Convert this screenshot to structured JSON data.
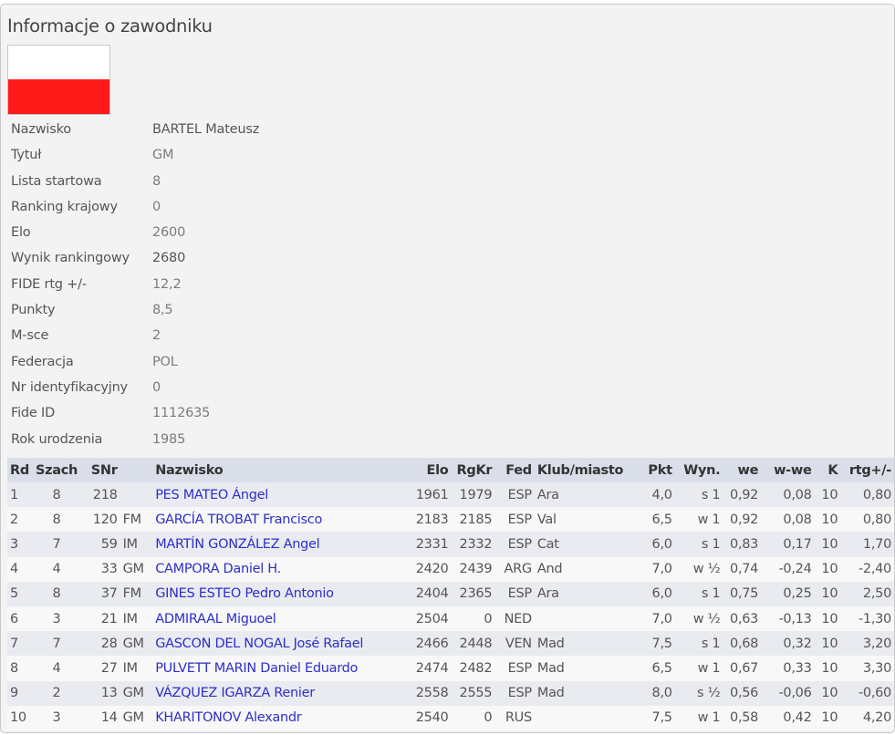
{
  "page_title": "Informacje o zawodniku",
  "flag": {
    "icon": "poland-flag-icon",
    "colors": [
      "#ffffff",
      "#ff1a1a"
    ]
  },
  "player": [
    {
      "label": "Nazwisko",
      "value": "BARTEL Mateusz"
    },
    {
      "label": "Tytuł",
      "value": "GM"
    },
    {
      "label": "Lista startowa",
      "value": "8"
    },
    {
      "label": "Ranking krajowy",
      "value": "0"
    },
    {
      "label": "Elo",
      "value": "2600"
    },
    {
      "label": "Wynik rankingowy",
      "value": "2680"
    },
    {
      "label": "FIDE rtg +/-",
      "value": "12,2"
    },
    {
      "label": "Punkty",
      "value": "8,5"
    },
    {
      "label": "M-sce",
      "value": "2"
    },
    {
      "label": "Federacja",
      "value": "POL"
    },
    {
      "label": "Nr identyfikacyjny",
      "value": "0"
    },
    {
      "label": "Fide ID",
      "value": "1112635"
    },
    {
      "label": "Rok urodzenia",
      "value": "1985"
    }
  ],
  "games_table": {
    "headers": [
      "Rd",
      "Szach",
      "SNr",
      "",
      "Nazwisko",
      "Elo",
      "RgKr",
      "Fed",
      "Klub/miasto",
      "Pkt",
      "Wyn.",
      "we",
      "w-we",
      "K",
      "rtg+/-"
    ],
    "rows": [
      [
        "1",
        "8",
        "218",
        "",
        "PES MATEO Ángel",
        "1961",
        "1979",
        "ESP",
        "Ara",
        "4,0",
        "s 1",
        "0,92",
        "0,08",
        "10",
        "0,80"
      ],
      [
        "2",
        "8",
        "120",
        "FM",
        "GARCÍA TROBAT Francisco",
        "2183",
        "2185",
        "ESP",
        "Val",
        "6,5",
        "w 1",
        "0,92",
        "0,08",
        "10",
        "0,80"
      ],
      [
        "3",
        "7",
        "59",
        "IM",
        "MARTÍN GONZÁLEZ Angel",
        "2331",
        "2332",
        "ESP",
        "Cat",
        "6,0",
        "s 1",
        "0,83",
        "0,17",
        "10",
        "1,70"
      ],
      [
        "4",
        "4",
        "33",
        "GM",
        "CAMPORA Daniel H.",
        "2420",
        "2439",
        "ARG",
        "And",
        "7,0",
        "w ½",
        "0,74",
        "-0,24",
        "10",
        "-2,40"
      ],
      [
        "5",
        "8",
        "37",
        "FM",
        "GINES ESTEO Pedro Antonio",
        "2404",
        "2365",
        "ESP",
        "Ara",
        "6,0",
        "s 1",
        "0,75",
        "0,25",
        "10",
        "2,50"
      ],
      [
        "6",
        "3",
        "21",
        "IM",
        "ADMIRAAL Miguoel",
        "2504",
        "0",
        "NED",
        "",
        "7,0",
        "w ½",
        "0,63",
        "-0,13",
        "10",
        "-1,30"
      ],
      [
        "7",
        "7",
        "28",
        "GM",
        "GASCON DEL NOGAL José Rafael",
        "2466",
        "2448",
        "VEN",
        "Mad",
        "7,5",
        "s 1",
        "0,68",
        "0,32",
        "10",
        "3,20"
      ],
      [
        "8",
        "4",
        "27",
        "IM",
        "PULVETT MARIN Daniel Eduardo",
        "2474",
        "2482",
        "ESP",
        "Mad",
        "6,5",
        "w 1",
        "0,67",
        "0,33",
        "10",
        "3,30"
      ],
      [
        "9",
        "2",
        "13",
        "GM",
        "VÁZQUEZ IGARZA Renier",
        "2558",
        "2555",
        "ESP",
        "Mad",
        "8,0",
        "s ½",
        "0,56",
        "-0,06",
        "10",
        "-0,60"
      ],
      [
        "10",
        "3",
        "14",
        "GM",
        "KHARITONOV Alexandr",
        "2540",
        "0",
        "RUS",
        "",
        "7,5",
        "w 1",
        "0,58",
        "0,42",
        "10",
        "4,20"
      ]
    ]
  }
}
